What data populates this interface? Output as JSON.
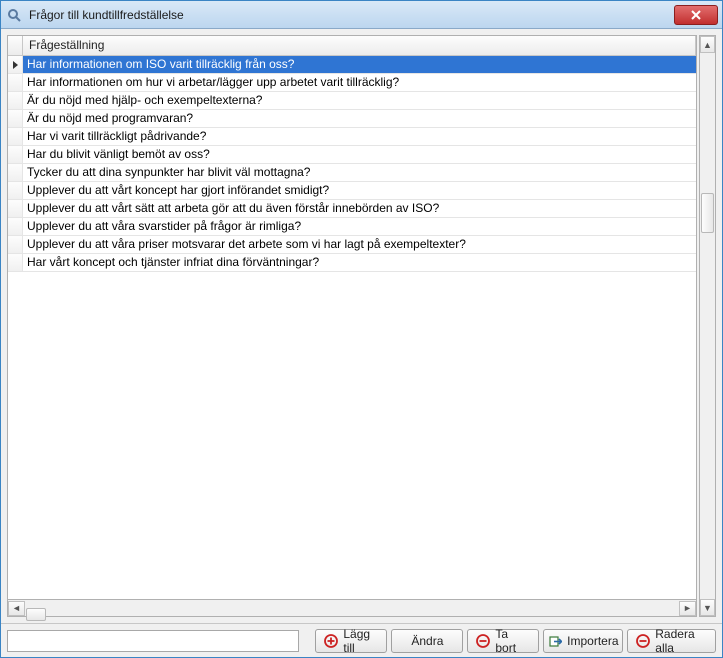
{
  "window": {
    "title": "Frågor till kundtillfredställelse"
  },
  "table": {
    "column_header": "Frågeställning",
    "selected_index": 0,
    "rows": [
      "Har informationen om ISO varit tillräcklig från oss?",
      "Har informationen om hur vi arbetar/lägger upp arbetet varit tillräcklig?",
      "Är du nöjd med hjälp- och exempeltexterna?",
      "Är du nöjd med programvaran?",
      "Har vi varit tillräckligt pådrivande?",
      "Har du blivit vänligt bemöt av oss?",
      "Tycker du att dina synpunkter har blivit väl mottagna?",
      "Upplever du att vårt koncept har gjort införandet smidigt?",
      "Upplever du att vårt sätt att arbeta gör att du även förstår innebörden av ISO?",
      "Upplever du att våra svarstider på frågor är rimliga?",
      "Upplever du att våra priser motsvarar det arbete som vi har lagt på exempeltexter?",
      "Har vårt koncept och tjänster infriat dina förväntningar?"
    ]
  },
  "footer": {
    "input_value": "",
    "add_label": "Lägg till",
    "edit_label": "Ändra",
    "delete_label": "Ta bort",
    "import_label": "Importera",
    "delete_all_label": "Radera alla"
  }
}
